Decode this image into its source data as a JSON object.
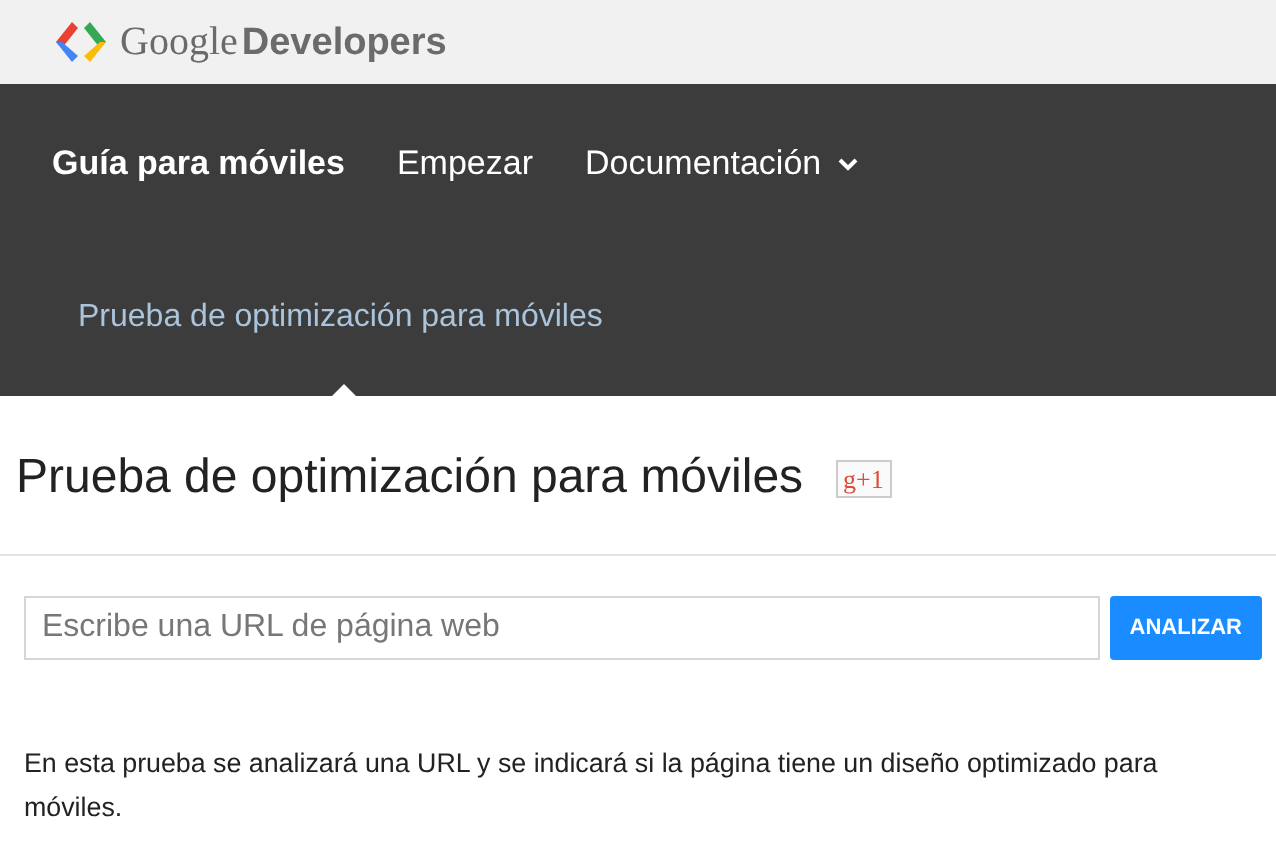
{
  "header": {
    "brand_first": "Google",
    "brand_second": "Developers"
  },
  "nav": [
    {
      "label": "Guía para móviles",
      "selected": true,
      "has_menu": false
    },
    {
      "label": "Empezar",
      "selected": false,
      "has_menu": false
    },
    {
      "label": "Documentación",
      "selected": false,
      "has_menu": true
    }
  ],
  "subnav": [
    {
      "label": "Prueba de optimización para móviles",
      "selected": true
    }
  ],
  "page": {
    "title": "Prueba de optimización para móviles",
    "plus_one": "g+1",
    "url_field": {
      "placeholder": "Escribe una URL de página web"
    },
    "button": "ANALIZAR",
    "description": "En esta prueba se analizará una URL y se indicará si la página tiene un diseño optimizado para móviles."
  }
}
